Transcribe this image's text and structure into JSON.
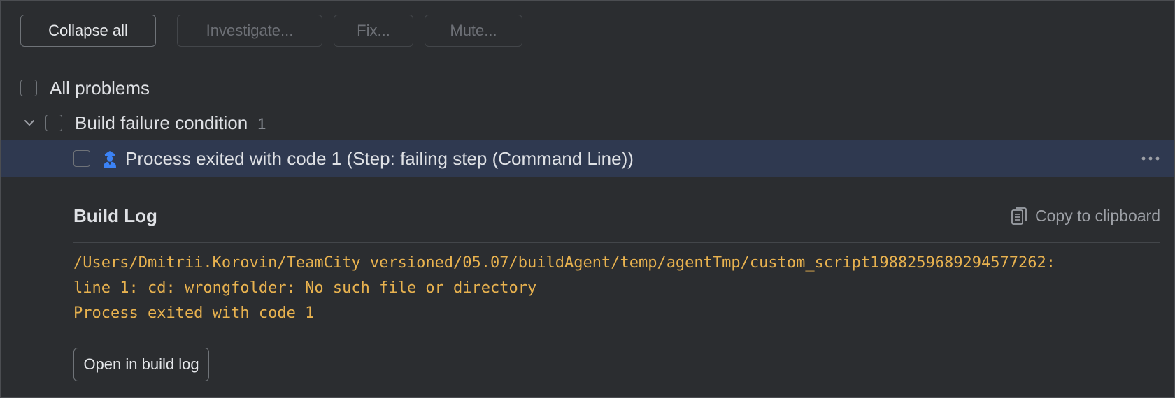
{
  "toolbar": {
    "collapse_all": "Collapse all",
    "investigate": "Investigate...",
    "fix": "Fix...",
    "mute": "Mute..."
  },
  "tree": {
    "all_problems": "All problems",
    "group": {
      "label": "Build failure condition",
      "count": "1"
    },
    "problem": {
      "label": "Process exited with code 1 (Step: failing step (Command Line))",
      "icon": "investigator-icon"
    }
  },
  "build_log": {
    "title": "Build Log",
    "copy_label": "Copy to clipboard",
    "lines": [
      "/Users/Dmitrii.Korovin/TeamCity versioned/05.07/buildAgent/temp/agentTmp/custom_script1988259689294577262:",
      "line 1: cd: wrongfolder: No such file or directory",
      "Process exited with code 1"
    ],
    "open_button": "Open in build log"
  },
  "colors": {
    "background": "#2b2d30",
    "selected_row": "#2f3950",
    "log_text": "#e8b24f",
    "accent_icon": "#3b82f6"
  }
}
